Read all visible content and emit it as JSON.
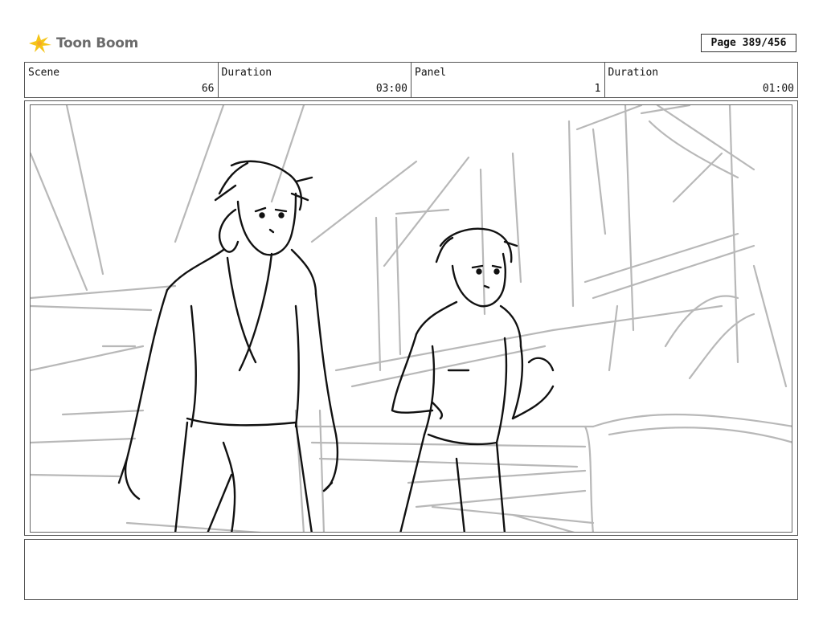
{
  "brand": {
    "logo_text": "Toon Boom"
  },
  "page": {
    "label": "Page 389/456"
  },
  "header": {
    "scene_label": "Scene",
    "scene_value": "66",
    "duration_label": "Duration",
    "duration_value": "03:00",
    "panel_label": "Panel",
    "panel_value": "1",
    "panel_duration_label": "Duration",
    "panel_duration_value": "01:00"
  },
  "notes": {
    "text": ""
  }
}
